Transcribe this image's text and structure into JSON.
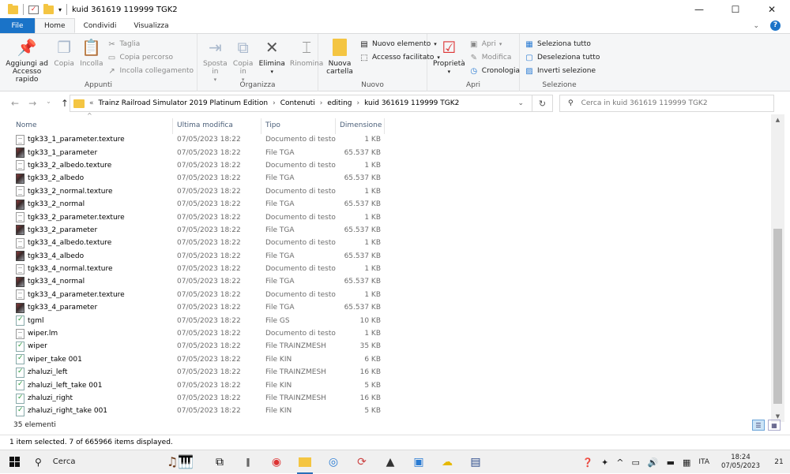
{
  "window": {
    "title": "kuid 361619 119999 TGK2",
    "controls": {
      "minimize": "—",
      "maximize": "☐",
      "close": "✕"
    }
  },
  "ribbon": {
    "tabs": [
      "File",
      "Home",
      "Condividi",
      "Visualizza"
    ],
    "groups": {
      "appunti": {
        "label": "Appunti",
        "pin": "Aggiungi ad Accesso rapido",
        "copy": "Copia",
        "paste": "Incolla",
        "cut": "Taglia",
        "copy_path": "Copia percorso",
        "paste_shortcut": "Incolla collegamento"
      },
      "organizza": {
        "label": "Organizza",
        "move": "Sposta in",
        "copyto": "Copia in",
        "delete": "Elimina",
        "rename": "Rinomina"
      },
      "nuovo": {
        "label": "Nuovo",
        "new_folder": "Nuova cartella",
        "new_item": "Nuovo elemento",
        "easy_access": "Accesso facilitato"
      },
      "apri": {
        "label": "Apri",
        "properties": "Proprietà",
        "open": "Apri",
        "edit": "Modifica",
        "history": "Cronologia"
      },
      "selezione": {
        "label": "Selezione",
        "select_all": "Seleziona tutto",
        "select_none": "Deseleziona tutto",
        "invert": "Inverti selezione"
      }
    }
  },
  "address": {
    "crumbs": [
      "Trainz Railroad Simulator 2019 Platinum Edition",
      "Contenuti",
      "editing",
      "kuid 361619 119999 TGK2"
    ],
    "search_placeholder": "Cerca in kuid 361619 119999 TGK2"
  },
  "columns": [
    "Nome",
    "Ultima modifica",
    "Tipo",
    "Dimensione"
  ],
  "files": [
    {
      "name": "tgk33_1_parameter.texture",
      "date": "07/05/2023 18:22",
      "type": "Documento di testo",
      "size": "1 KB",
      "icon": "text"
    },
    {
      "name": "tgk33_1_parameter",
      "date": "07/05/2023 18:22",
      "type": "File TGA",
      "size": "65.537 KB",
      "icon": "tga"
    },
    {
      "name": "tgk33_2_albedo.texture",
      "date": "07/05/2023 18:22",
      "type": "Documento di testo",
      "size": "1 KB",
      "icon": "text"
    },
    {
      "name": "tgk33_2_albedo",
      "date": "07/05/2023 18:22",
      "type": "File TGA",
      "size": "65.537 KB",
      "icon": "tga"
    },
    {
      "name": "tgk33_2_normal.texture",
      "date": "07/05/2023 18:22",
      "type": "Documento di testo",
      "size": "1 KB",
      "icon": "text"
    },
    {
      "name": "tgk33_2_normal",
      "date": "07/05/2023 18:22",
      "type": "File TGA",
      "size": "65.537 KB",
      "icon": "tga"
    },
    {
      "name": "tgk33_2_parameter.texture",
      "date": "07/05/2023 18:22",
      "type": "Documento di testo",
      "size": "1 KB",
      "icon": "text"
    },
    {
      "name": "tgk33_2_parameter",
      "date": "07/05/2023 18:22",
      "type": "File TGA",
      "size": "65.537 KB",
      "icon": "tga"
    },
    {
      "name": "tgk33_4_albedo.texture",
      "date": "07/05/2023 18:22",
      "type": "Documento di testo",
      "size": "1 KB",
      "icon": "text"
    },
    {
      "name": "tgk33_4_albedo",
      "date": "07/05/2023 18:22",
      "type": "File TGA",
      "size": "65.537 KB",
      "icon": "tga"
    },
    {
      "name": "tgk33_4_normal.texture",
      "date": "07/05/2023 18:22",
      "type": "Documento di testo",
      "size": "1 KB",
      "icon": "text"
    },
    {
      "name": "tgk33_4_normal",
      "date": "07/05/2023 18:22",
      "type": "File TGA",
      "size": "65.537 KB",
      "icon": "tga"
    },
    {
      "name": "tgk33_4_parameter.texture",
      "date": "07/05/2023 18:22",
      "type": "Documento di testo",
      "size": "1 KB",
      "icon": "text"
    },
    {
      "name": "tgk33_4_parameter",
      "date": "07/05/2023 18:22",
      "type": "File TGA",
      "size": "65.537 KB",
      "icon": "tga"
    },
    {
      "name": "tgml",
      "date": "07/05/2023 18:22",
      "type": "File GS",
      "size": "10 KB",
      "icon": "gs"
    },
    {
      "name": "wiper.lm",
      "date": "07/05/2023 18:22",
      "type": "Documento di testo",
      "size": "1 KB",
      "icon": "text"
    },
    {
      "name": "wiper",
      "date": "07/05/2023 18:22",
      "type": "File TRAINZMESH",
      "size": "35 KB",
      "icon": "gs"
    },
    {
      "name": "wiper_take 001",
      "date": "07/05/2023 18:22",
      "type": "File KIN",
      "size": "6 KB",
      "icon": "gs"
    },
    {
      "name": "zhaluzi_left",
      "date": "07/05/2023 18:22",
      "type": "File TRAINZMESH",
      "size": "16 KB",
      "icon": "gs"
    },
    {
      "name": "zhaluzi_left_take 001",
      "date": "07/05/2023 18:22",
      "type": "File KIN",
      "size": "5 KB",
      "icon": "gs"
    },
    {
      "name": "zhaluzi_right",
      "date": "07/05/2023 18:22",
      "type": "File TRAINZMESH",
      "size": "16 KB",
      "icon": "gs"
    },
    {
      "name": "zhaluzi_right_take 001",
      "date": "07/05/2023 18:22",
      "type": "File KIN",
      "size": "5 KB",
      "icon": "gs"
    }
  ],
  "status": {
    "count": "35 elementi",
    "selection": "1 item selected. 7 of 665966 items displayed."
  },
  "taskbar": {
    "search": "Cerca",
    "lang": "ITA",
    "time": "18:24",
    "date": "07/05/2023",
    "notifications": "21"
  }
}
